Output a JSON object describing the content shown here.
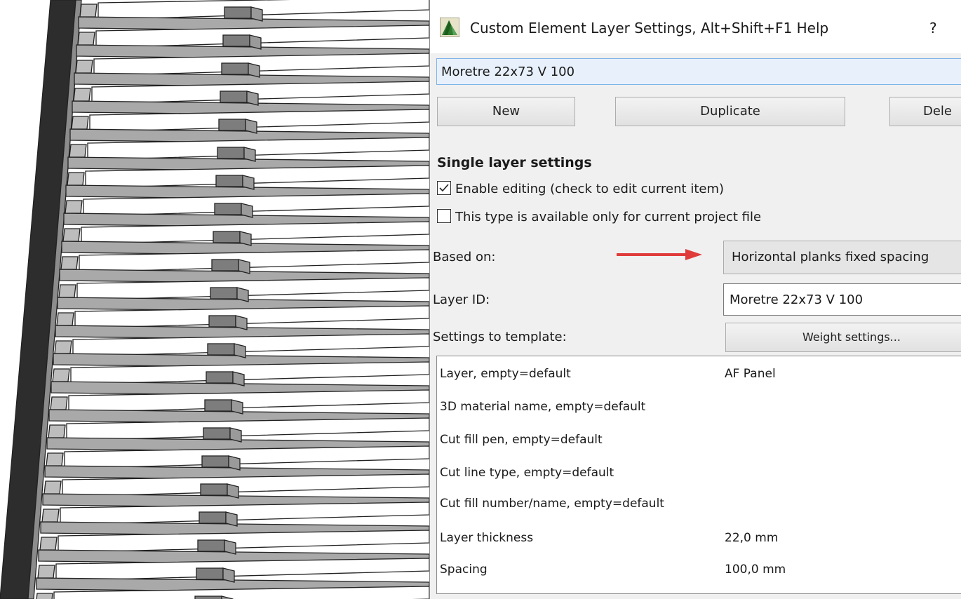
{
  "dialog": {
    "title": "Custom Element Layer Settings, Alt+Shift+F1 Help",
    "help_label": "?",
    "app_icon": "archicad-icon",
    "element_name": "Moretre 22x73 V 100",
    "buttons": {
      "new": "New",
      "duplicate": "Duplicate",
      "delete": "Dele"
    },
    "section_heading": "Single layer settings",
    "checkboxes": [
      {
        "label": "Enable editing (check to edit current item)",
        "checked": true
      },
      {
        "label": "This type is available only for current project file",
        "checked": false
      }
    ],
    "based_on": {
      "label": "Based on:",
      "value": "Horizontal planks fixed spacing"
    },
    "layer_id": {
      "label": "Layer ID:",
      "value": "Moretre 22x73 V 100"
    },
    "settings_template": {
      "label": "Settings to template:",
      "button": "Weight settings..."
    },
    "properties": [
      {
        "name": "Layer, empty=default",
        "value": "AF Panel"
      },
      {
        "name": "3D material name, empty=default",
        "value": ""
      },
      {
        "name": "Cut fill pen, empty=default",
        "value": ""
      },
      {
        "name": "Cut line type, empty=default",
        "value": ""
      },
      {
        "name": "Cut fill number/name, empty=default",
        "value": ""
      },
      {
        "name": "Layer thickness",
        "value": "22,0 mm"
      },
      {
        "name": "Spacing",
        "value": "100,0 mm"
      }
    ]
  },
  "colors": {
    "annotation_arrow": "#e03b3b",
    "field_focus": "#7eb4ea",
    "plank_top": "#ffffff",
    "plank_front": "#a9a9a9",
    "post": "#7d7d7d"
  }
}
